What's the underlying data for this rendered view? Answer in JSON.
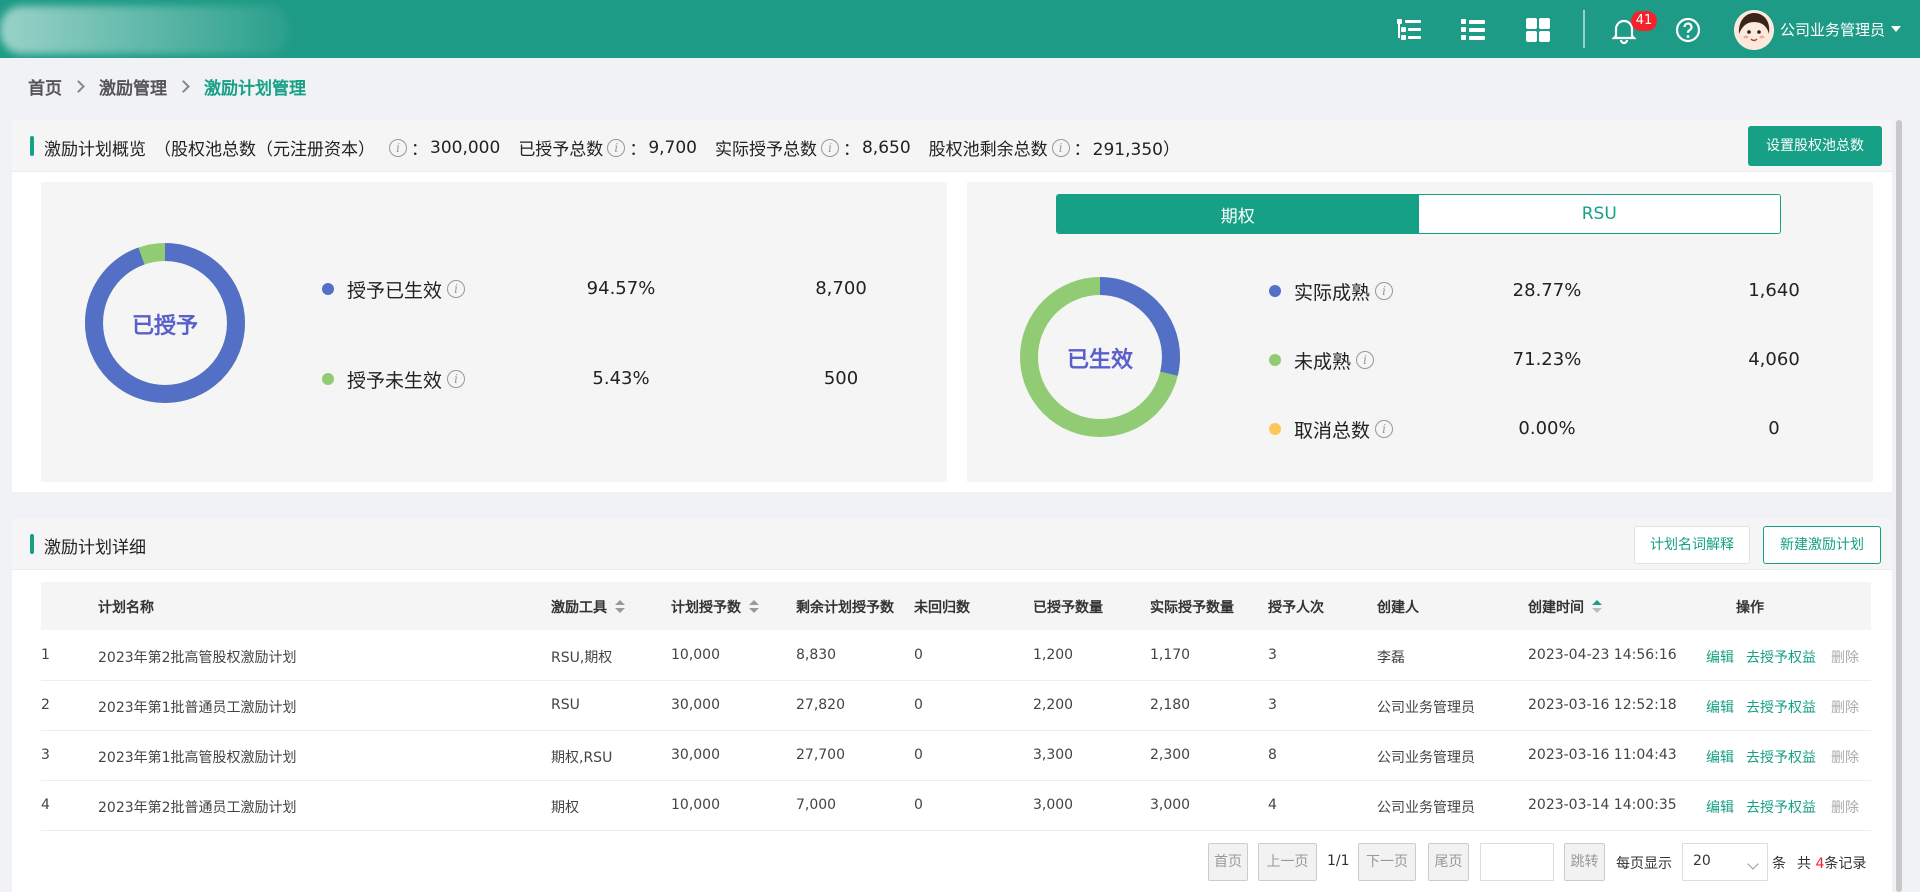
{
  "header": {
    "notification_count": "41",
    "user_name": "公司业务管理员",
    "icons": [
      "tree-list-icon",
      "list-icon",
      "grid-icon",
      "bell-icon",
      "help-icon"
    ]
  },
  "breadcrumb": [
    "首页",
    "激励管理",
    "激励计划管理"
  ],
  "overview": {
    "title": "激励计划概览",
    "pool_label": "（股权池总数（元注册资本）",
    "pool_value": "300,000",
    "granted_label": "已授予总数",
    "granted_value": "9,700",
    "actual_label": "实际授予总数",
    "actual_value": "8,650",
    "remaining_label": "股权池剩余总数",
    "remaining_value": "291,350）",
    "set_pool_button": "设置股权池总数",
    "colon": "："
  },
  "granted_panel": {
    "center_label": "已授予",
    "items": [
      {
        "label": "授予已生效",
        "percent": "94.57%",
        "value": "8,700",
        "color": "#5470c6"
      },
      {
        "label": "授予未生效",
        "percent": "5.43%",
        "value": "500",
        "color": "#91cc75"
      }
    ]
  },
  "effective_panel": {
    "tabs": [
      "期权",
      "RSU"
    ],
    "active_tab": "期权",
    "center_label": "已生效",
    "items": [
      {
        "label": "实际成熟",
        "percent": "28.77%",
        "value": "1,640",
        "color": "#5470c6"
      },
      {
        "label": "未成熟",
        "percent": "71.23%",
        "value": "4,060",
        "color": "#91cc75"
      },
      {
        "label": "取消总数",
        "percent": "0.00%",
        "value": "0",
        "color": "#fac858"
      }
    ]
  },
  "details": {
    "title": "激励计划详细",
    "glossary_button": "计划名词解释",
    "new_plan_button": "新建激励计划",
    "columns": [
      "计划名称",
      "激励工具",
      "计划授予数",
      "剩余计划授予数",
      "未回归数",
      "已授予数量",
      "实际授予数量",
      "授予人次",
      "创建人",
      "创建时间",
      "操作"
    ],
    "rows": [
      {
        "no": "1",
        "name": "2023年第2批高管股权激励计划",
        "tool": "RSU,期权",
        "planned": "10,000",
        "remaining": "8,830",
        "unreturned": "0",
        "granted": "1,200",
        "actual": "1,170",
        "times": "3",
        "creator": "李磊",
        "created": "2023-04-23 14:56:16"
      },
      {
        "no": "2",
        "name": "2023年第1批普通员工激励计划",
        "tool": "RSU",
        "planned": "30,000",
        "remaining": "27,820",
        "unreturned": "0",
        "granted": "2,200",
        "actual": "2,180",
        "times": "3",
        "creator": "公司业务管理员",
        "created": "2023-03-16 12:52:18"
      },
      {
        "no": "3",
        "name": "2023年第1批高管股权激励计划",
        "tool": "期权,RSU",
        "planned": "30,000",
        "remaining": "27,700",
        "unreturned": "0",
        "granted": "3,300",
        "actual": "2,300",
        "times": "8",
        "creator": "公司业务管理员",
        "created": "2023-03-16 11:04:43"
      },
      {
        "no": "4",
        "name": "2023年第2批普通员工激励计划",
        "tool": "期权",
        "planned": "10,000",
        "remaining": "7,000",
        "unreturned": "0",
        "granted": "3,000",
        "actual": "3,000",
        "times": "4",
        "creator": "公司业务管理员",
        "created": "2023-03-14 14:00:35"
      }
    ],
    "actions": {
      "edit": "编辑",
      "grant": "去授予权益",
      "delete": "删除"
    }
  },
  "pagination": {
    "first": "首页",
    "prev": "上一页",
    "page_info": "1/1",
    "next": "下一页",
    "last": "尾页",
    "jump": "跳转",
    "per_page_label": "每页显示",
    "per_page_value": "20",
    "unit": "条",
    "total_prefix": "共",
    "total_count": "4",
    "total_suffix": "条记录"
  }
}
